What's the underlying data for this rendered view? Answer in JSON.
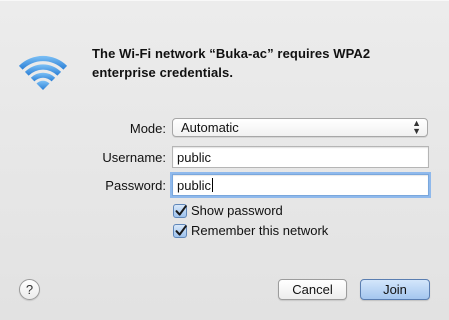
{
  "dialog": {
    "message": "The Wi-Fi network “Buka-ac” requires WPA2 enterprise credentials.",
    "mode": {
      "label": "Mode:",
      "selected": "Automatic"
    },
    "username": {
      "label": "Username:",
      "value": "public"
    },
    "password": {
      "label": "Password:",
      "value": "public"
    },
    "show_password": {
      "label": "Show password",
      "checked": true
    },
    "remember_network": {
      "label": "Remember this network",
      "checked": true
    },
    "help_label": "?",
    "cancel_label": "Cancel",
    "join_label": "Join"
  },
  "icons": {
    "wifi": "wifi-icon",
    "select_arrows": "up-down-arrows-icon",
    "checkmark": "checkmark-icon"
  },
  "colors": {
    "wifi_blue": "#3b8fe0",
    "focus_ring": "#8fb9ec",
    "default_button": "#a4c6ef"
  }
}
